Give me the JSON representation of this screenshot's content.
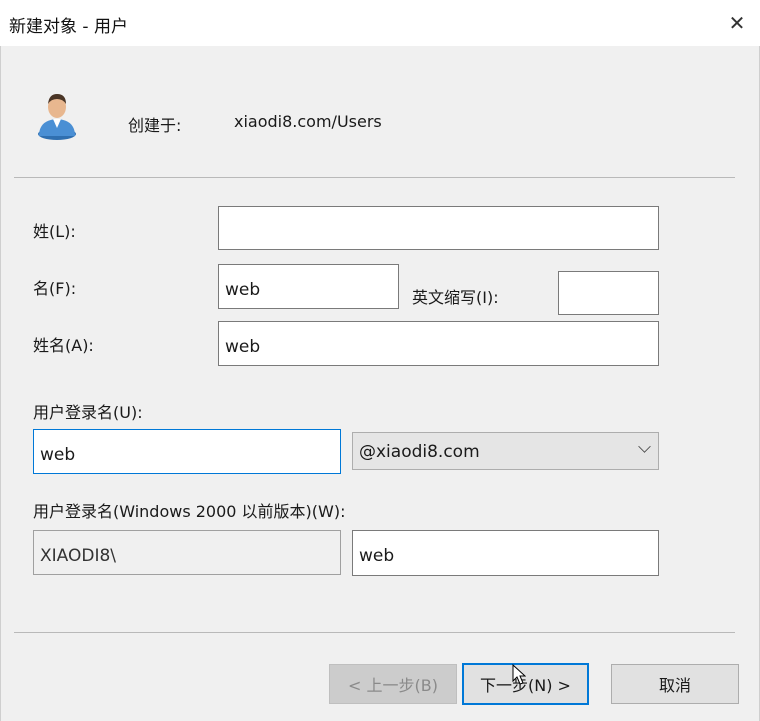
{
  "window": {
    "title": "新建对象 - 用户",
    "close_glyph": "✕"
  },
  "header": {
    "created_in_label": "创建于:",
    "created_in_value": "xiaodi8.com/Users"
  },
  "form": {
    "last_name_label": "姓(L):",
    "last_name_value": "",
    "first_name_label": "名(F):",
    "first_name_value": "web",
    "initials_label": "英文缩写(I):",
    "initials_value": "",
    "full_name_label": "姓名(A):",
    "full_name_value": "web",
    "logon_name_label": "用户登录名(U):",
    "logon_name_value": "web",
    "domain_suffix": "@xiaodi8.com",
    "pre2000_label": "用户登录名(Windows 2000 以前版本)(W):",
    "pre2000_domain": "XIAODI8\\",
    "pre2000_value": "web"
  },
  "buttons": {
    "back": "< 上一步(B)",
    "next": "下一步(N) >",
    "cancel": "取消"
  },
  "colors": {
    "accent": "#0078d7",
    "background": "#f0f0f0"
  }
}
